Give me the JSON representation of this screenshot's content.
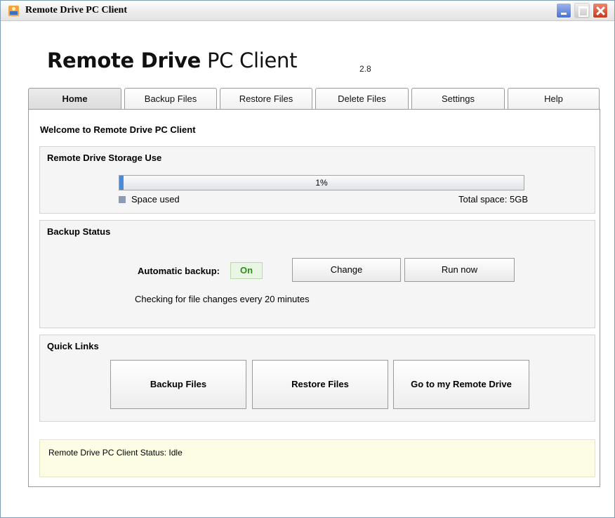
{
  "window": {
    "title": "Remote Drive PC Client",
    "icon": "app-icon"
  },
  "header": {
    "logo_bold": "Remote Drive",
    "logo_light": "PC Client",
    "version": "2.8"
  },
  "tabs": [
    {
      "label": "Home",
      "active": true
    },
    {
      "label": "Backup Files",
      "active": false
    },
    {
      "label": "Restore Files",
      "active": false
    },
    {
      "label": "Delete Files",
      "active": false
    },
    {
      "label": "Settings",
      "active": false
    },
    {
      "label": "Help",
      "active": false
    }
  ],
  "home": {
    "welcome": "Welcome to Remote Drive PC Client",
    "storage": {
      "title": "Remote Drive Storage Use",
      "percent_label": "1%",
      "used_fraction": 0.01,
      "legend_label": "Space used",
      "total_label": "Total space:  5GB"
    },
    "backup": {
      "title": "Backup Status",
      "auto_label": "Automatic backup:",
      "auto_state": "On",
      "change_label": "Change",
      "run_label": "Run now",
      "checking_text": "Checking for file changes every 20 minutes"
    },
    "quick_links": {
      "title": "Quick Links",
      "backup_label": "Backup Files",
      "restore_label": "Restore Files",
      "goto_label": "Go to my Remote Drive"
    },
    "status_text": "Remote Drive PC Client Status: Idle"
  },
  "colors": {
    "accent": "#4d8ad6",
    "on_green": "#2d8c1c",
    "status_bg": "#fdfde6"
  }
}
